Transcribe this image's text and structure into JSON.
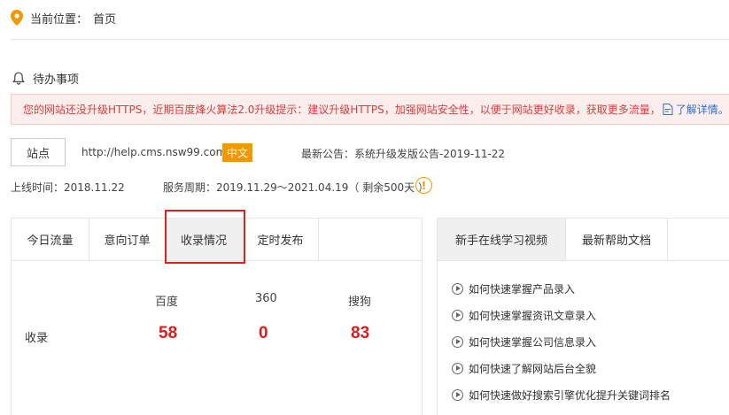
{
  "breadcrumb": {
    "label": "当前位置：",
    "current": "首页"
  },
  "todo": {
    "title": "待办事项"
  },
  "notice": {
    "text": "您的网站还没升级HTTPS，近期百度烽火算法2.0升级提示：建议升级HTTPS，加强网站安全性，以便于网站更好收录，获取更多流量，",
    "link": "了解详情。"
  },
  "site": {
    "button_label": "站点",
    "url": "http://help.cms.nsw99.com",
    "language": "中文",
    "announcement": "最新公告：系统升级发版公告-2019-11-22",
    "online_time": "上线时间：2018.11.22",
    "service_period": "服务周期：2019.11.29～2021.04.19（ 剩余500天 ）"
  },
  "left_tabs": [
    "今日流量",
    "意向订单",
    "收录情况",
    "定时发布"
  ],
  "active_left_tab": "收录情况",
  "stats": {
    "row_label": "收录",
    "columns": [
      {
        "name": "百度",
        "value": "58"
      },
      {
        "name": "360",
        "value": "0"
      },
      {
        "name": "搜狗",
        "value": "83"
      }
    ]
  },
  "right_tabs": [
    "新手在线学习视频",
    "最新帮助文档"
  ],
  "active_right_tab": "新手在线学习视频",
  "videos": [
    "如何快速掌握产品录入",
    "如何快速掌握资讯文章录入",
    "如何快速掌握公司信息录入",
    "如何快速了解网站后台全貌",
    "如何快速做好搜索引擎优化提升关键词排名"
  ],
  "colors": {
    "accent": "#f39800",
    "danger": "#e01b1b",
    "link": "#2f6fd0",
    "highlight": "#e02020"
  }
}
